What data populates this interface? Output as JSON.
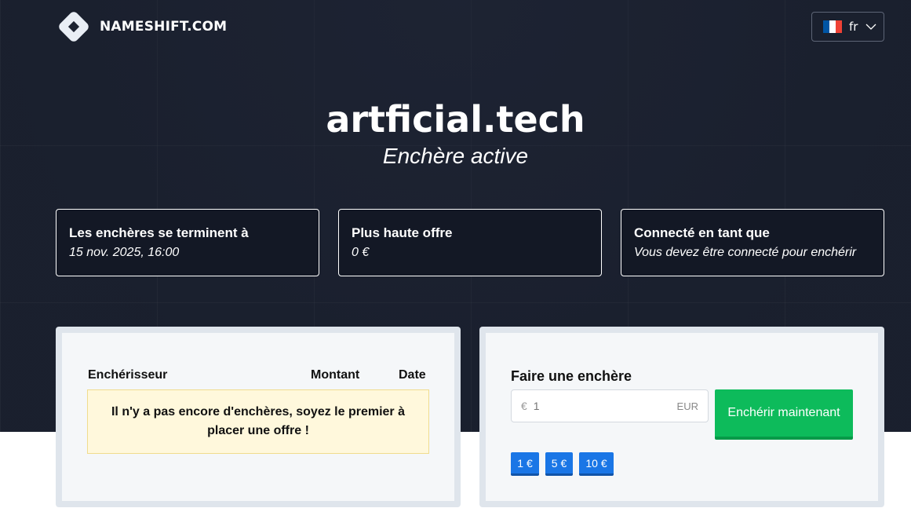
{
  "header": {
    "brand": "NAMESHIFT.COM",
    "language": {
      "code": "fr",
      "flag_colors": [
        "#0055a4",
        "#ffffff",
        "#ef4135"
      ]
    }
  },
  "hero": {
    "domain": "artficial.tech",
    "status": "Enchère active"
  },
  "info_cards": [
    {
      "title": "Les enchères se terminent à",
      "value": "15 nov. 2025, 16:00"
    },
    {
      "title": "Plus haute offre",
      "value": "0 €"
    },
    {
      "title": "Connecté en tant que",
      "value": "Vous devez être connecté pour enchérir"
    }
  ],
  "bids_table": {
    "columns": [
      "Enchérisseur",
      "Montant",
      "Date"
    ],
    "empty_message": "Il n'y a pas encore d'enchères, soyez le premier à placer une offre !"
  },
  "bid_form": {
    "title": "Faire une enchère",
    "currency_symbol": "€",
    "amount_placeholder": "1",
    "currency_code": "EUR",
    "submit_label": "Enchérir maintenant",
    "quick_amounts": [
      "1 €",
      "5 €",
      "10 €"
    ]
  },
  "colors": {
    "hero_bg": "#1c2231",
    "submit_green": "#0dbb5b",
    "quick_blue": "#1a76e6",
    "notice_bg": "#fff8dc"
  }
}
